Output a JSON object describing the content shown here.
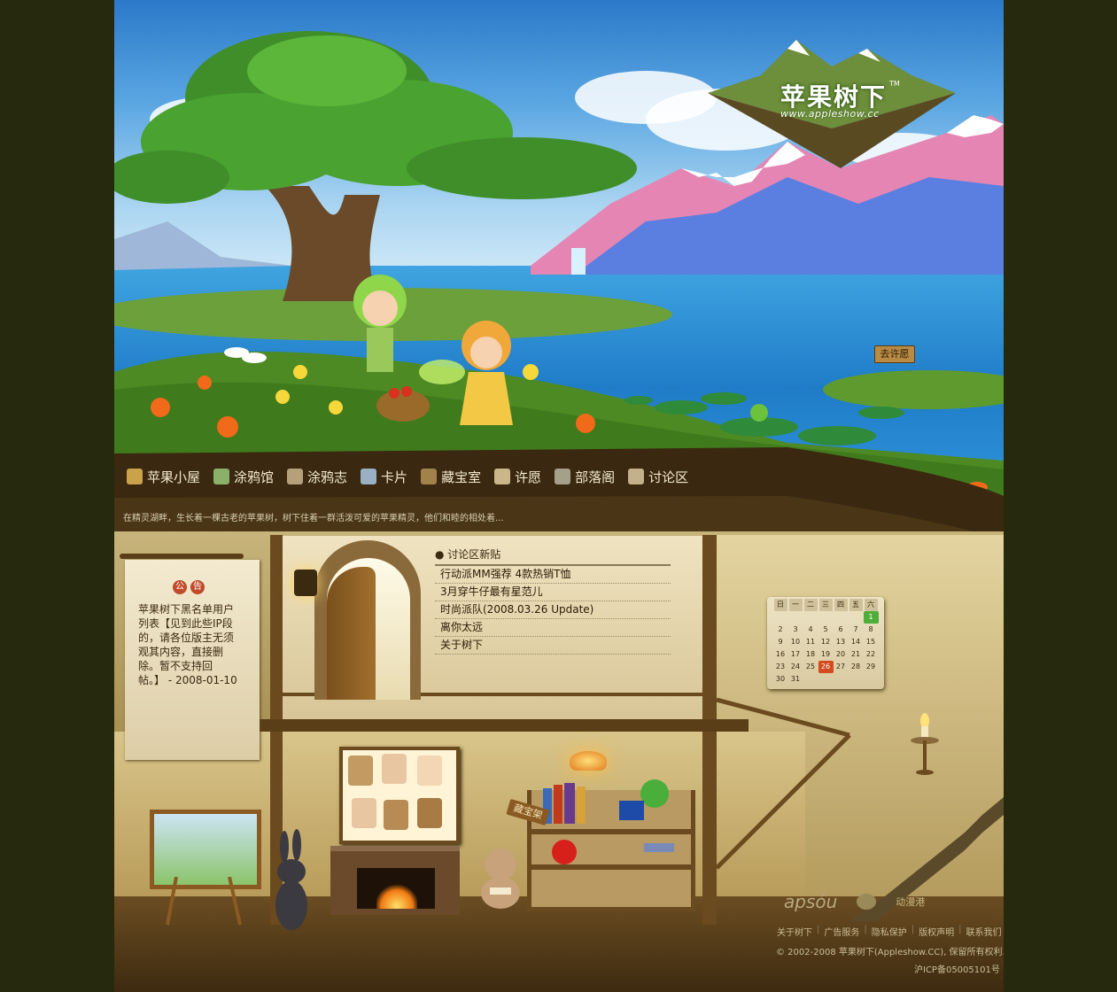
{
  "site": {
    "title": "苹果树下",
    "trademark": "TM",
    "url": "www.appleshow.cc"
  },
  "nav": [
    {
      "label": "苹果小屋",
      "icon": "house-icon",
      "color": "#c9a24a"
    },
    {
      "label": "涂鸦馆",
      "icon": "palette-icon",
      "color": "#8ab06a"
    },
    {
      "label": "涂鸦志",
      "icon": "notebook-icon",
      "color": "#b6a07a"
    },
    {
      "label": "卡片",
      "icon": "card-icon",
      "color": "#9ab0c4"
    },
    {
      "label": "藏宝室",
      "icon": "treasure-box-icon",
      "color": "#a0824a"
    },
    {
      "label": "许愿",
      "icon": "wish-bottle-icon",
      "color": "#cbb68a"
    },
    {
      "label": "部落阁",
      "icon": "book-icon",
      "color": "#a4a08a"
    },
    {
      "label": "讨论区",
      "icon": "people-icon",
      "color": "#c4b08a"
    }
  ],
  "tagline": "在精灵湖畔，生长着一棵古老的苹果树，树下住着一群活泼可爱的苹果精灵，他们和睦的相处着...",
  "scene": {
    "wish_sign": "去许愿"
  },
  "notice": {
    "title_chars": [
      "公",
      "告"
    ],
    "text": "苹果树下黑名单用户列表【见到此些IP段的，请各位版主无须观其内容，直接删除。暂不支持回帖。】 - 2008-01-10"
  },
  "forum": {
    "heading": "讨论区新贴",
    "posts": [
      "行动派MM强荐 4款热销T恤",
      "3月穿牛仔最有星范儿",
      "时尚派队(2008.03.26 Update)",
      "离你太远",
      "关于树下"
    ]
  },
  "calendar": {
    "weekdays": [
      "日",
      "一",
      "二",
      "三",
      "四",
      "五",
      "六"
    ],
    "weeks": [
      [
        "",
        "",
        "",
        "",
        "",
        "",
        "1"
      ],
      [
        "2",
        "3",
        "4",
        "5",
        "6",
        "7",
        "8"
      ],
      [
        "9",
        "10",
        "11",
        "12",
        "13",
        "14",
        "15"
      ],
      [
        "16",
        "17",
        "18",
        "19",
        "20",
        "21",
        "22"
      ],
      [
        "23",
        "24",
        "25",
        "26",
        "27",
        "28",
        "29"
      ],
      [
        "30",
        "31",
        "",
        "",
        "",
        "",
        ""
      ]
    ],
    "highlighted_green": "1",
    "highlighted_red": "26"
  },
  "room": {
    "treasure_sign": "藏宝架"
  },
  "footer": {
    "logos": [
      "apsóu",
      "动漫港"
    ],
    "links": [
      "关于树下",
      "广告服务",
      "隐私保护",
      "版权声明",
      "联系我们"
    ],
    "copyright": "© 2002-2008  苹果树下(Appleshow.CC), 保留所有权利.",
    "icp": "沪ICP备05005101号"
  },
  "colors": {
    "page_background": "#26290e",
    "nav_text": "#f3ead1",
    "footer_text": "#c9bd97"
  }
}
